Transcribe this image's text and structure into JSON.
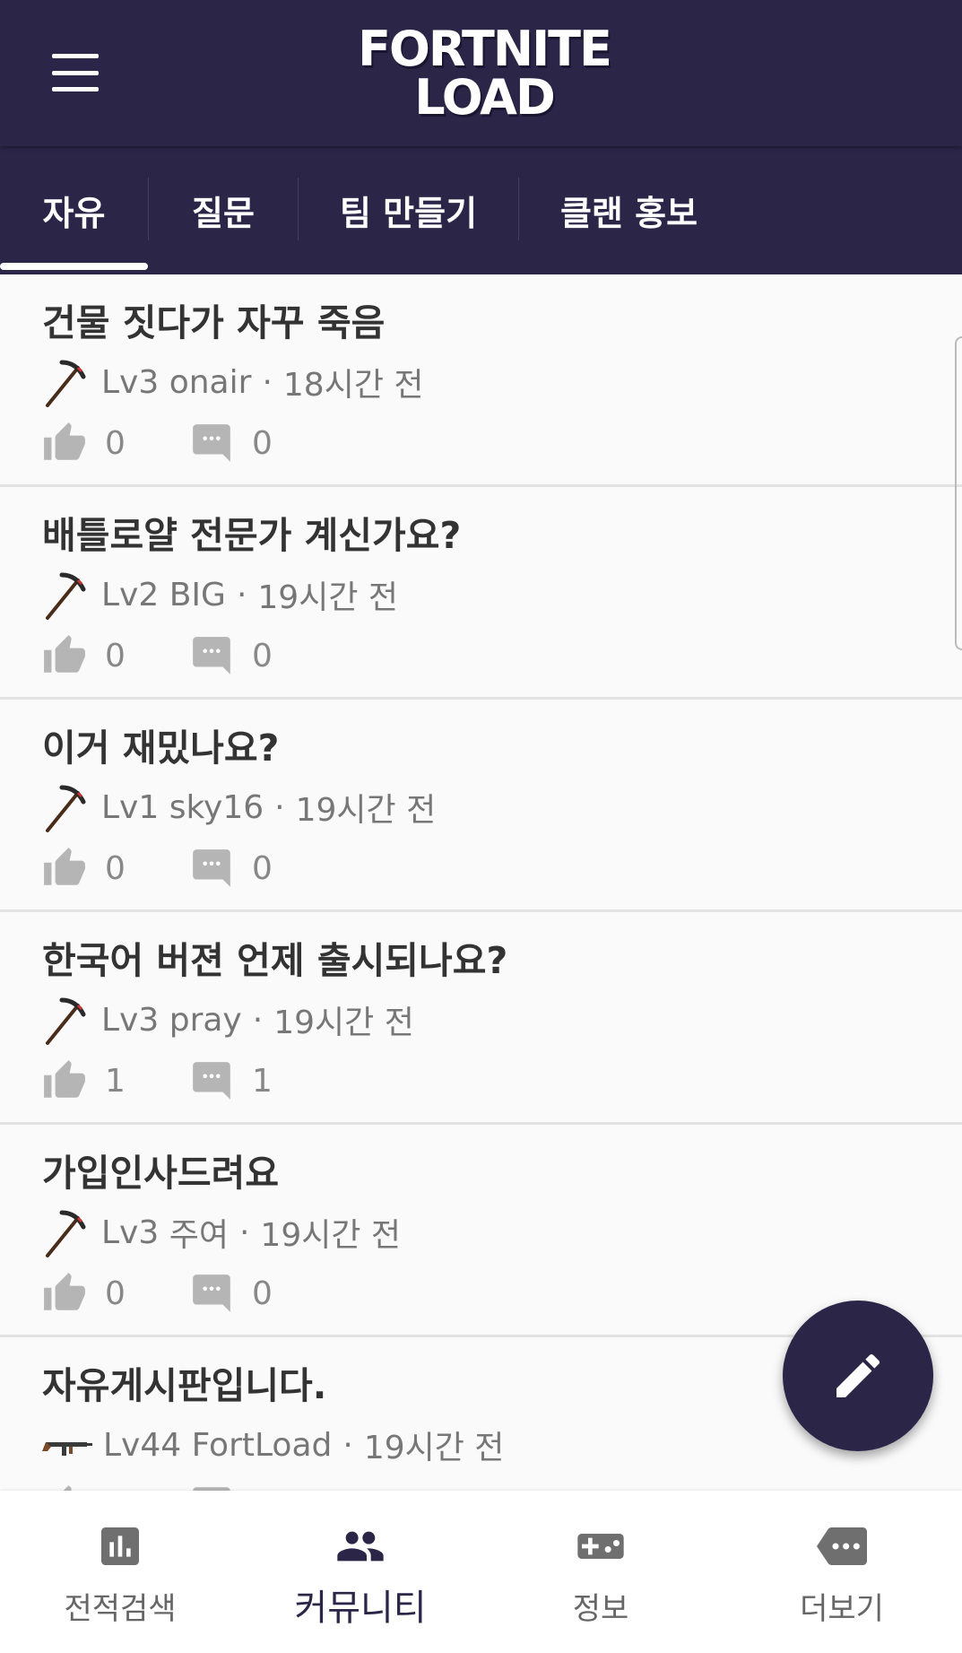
{
  "app": {
    "logo_line1": "FORTNITE",
    "logo_line2": "LOAD",
    "brand_color": "#2b2548"
  },
  "tabs": [
    {
      "label": "자유",
      "active": true
    },
    {
      "label": "질문",
      "active": false
    },
    {
      "label": "팀 만들기",
      "active": false
    },
    {
      "label": "클랜 홍보",
      "active": false
    }
  ],
  "posts": [
    {
      "title": "건물 짓다가 자꾸 죽음",
      "level": "Lv3",
      "author": "onair",
      "time": "18시간 전",
      "likes": "0",
      "comments": "0",
      "badge_icon": "pickaxe-icon"
    },
    {
      "title": "배틀로얄 전문가 계신가요?",
      "level": "Lv2",
      "author": "BIG",
      "time": "19시간 전",
      "likes": "0",
      "comments": "0",
      "badge_icon": "pickaxe-icon"
    },
    {
      "title": "이거 재밌나요?",
      "level": "Lv1",
      "author": "sky16",
      "time": "19시간 전",
      "likes": "0",
      "comments": "0",
      "badge_icon": "pickaxe-icon"
    },
    {
      "title": "한국어 버젼 언제 출시되나요?",
      "level": "Lv3",
      "author": "pray",
      "time": "19시간 전",
      "likes": "1",
      "comments": "1",
      "badge_icon": "pickaxe-icon"
    },
    {
      "title": "가입인사드려요",
      "level": "Lv3",
      "author": "주여",
      "time": "19시간 전",
      "likes": "0",
      "comments": "0",
      "badge_icon": "pickaxe-icon"
    },
    {
      "title": "자유게시판입니다.",
      "level": "Lv44",
      "author": "FortLoad",
      "time": "19시간 전",
      "likes": "",
      "comments": "",
      "badge_icon": "rifle-icon"
    }
  ],
  "meta_separator": "·",
  "fab": {
    "icon": "pencil-icon"
  },
  "bottom_nav": [
    {
      "label": "전적검색",
      "icon": "stats-chart-icon",
      "active": false
    },
    {
      "label": "커뮤니티",
      "icon": "people-icon",
      "active": true
    },
    {
      "label": "정보",
      "icon": "gamepad-icon",
      "active": false
    },
    {
      "label": "더보기",
      "icon": "more-icon",
      "active": false
    }
  ]
}
